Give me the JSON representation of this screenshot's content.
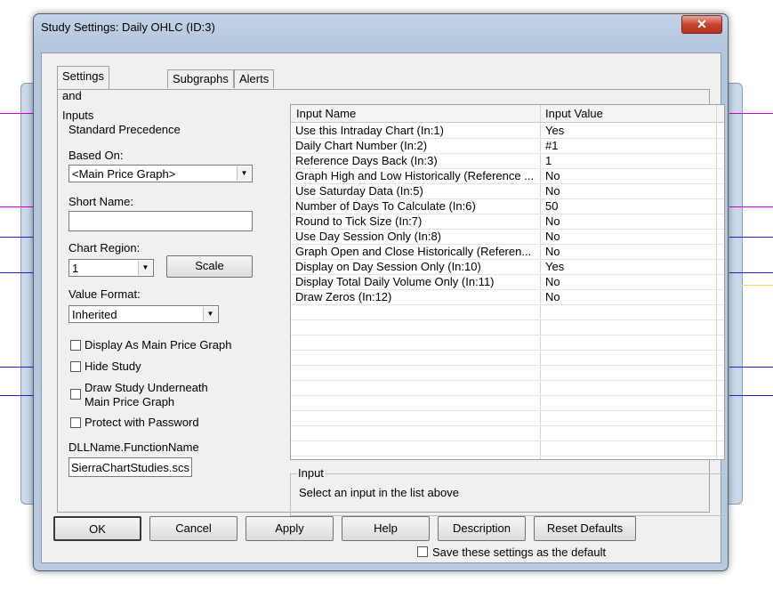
{
  "dialog": {
    "title": "Study Settings: Daily OHLC (ID:3)",
    "close_symbol": "✕"
  },
  "tabs": [
    {
      "label": "Settings and Inputs"
    },
    {
      "label": "Subgraphs"
    },
    {
      "label": "Alerts"
    }
  ],
  "left_panel": {
    "precedence_label": "Standard Precedence",
    "based_on_label": "Based On:",
    "based_on_value": "<Main Price Graph>",
    "short_name_label": "Short Name:",
    "short_name_value": "",
    "chart_region_label": "Chart Region:",
    "chart_region_value": "1",
    "scale_button": "Scale",
    "value_format_label": "Value Format:",
    "value_format_value": "Inherited",
    "checkboxes": [
      {
        "label": "Display As Main Price Graph",
        "checked": false
      },
      {
        "label": "Hide Study",
        "checked": false
      },
      {
        "label": "Draw Study Underneath",
        "label2": "Main Price Graph",
        "checked": false
      },
      {
        "label": "Protect with Password",
        "checked": false
      }
    ],
    "dll_label": "DLLName.FunctionName",
    "dll_value": "SierraChartStudies.scs"
  },
  "inputs_grid": {
    "columns": [
      "Input Name",
      "Input Value"
    ],
    "rows": [
      {
        "name": "Use this Intraday Chart  (In:1)",
        "value": "Yes"
      },
      {
        "name": "Daily Chart Number  (In:2)",
        "value": "#1"
      },
      {
        "name": "Reference Days Back  (In:3)",
        "value": "1"
      },
      {
        "name": "Graph High and Low Historically (Reference ...",
        "value": "No"
      },
      {
        "name": "Use Saturday Data  (In:5)",
        "value": "No"
      },
      {
        "name": "Number of Days To Calculate  (In:6)",
        "value": "50"
      },
      {
        "name": "Round to Tick Size  (In:7)",
        "value": "No"
      },
      {
        "name": "Use Day Session Only  (In:8)",
        "value": "No"
      },
      {
        "name": "Graph Open and Close Historically (Referen...",
        "value": "No"
      },
      {
        "name": "Display on Day Session Only  (In:10)",
        "value": "Yes"
      },
      {
        "name": "Display Total Daily Volume Only  (In:11)",
        "value": "No"
      },
      {
        "name": "Draw Zeros  (In:12)",
        "value": "No"
      }
    ]
  },
  "input_group": {
    "caption": "Input",
    "hint": "Select an input in the list above"
  },
  "buttons": {
    "ok": "OK",
    "cancel": "Cancel",
    "apply": "Apply",
    "help": "Help",
    "description": "Description",
    "reset_defaults": "Reset Defaults"
  },
  "save_default": {
    "label": "Save these settings as the default",
    "checked": false
  },
  "colors": {
    "magenta_line": "#d000d0",
    "blue_line": "#2020d0"
  }
}
